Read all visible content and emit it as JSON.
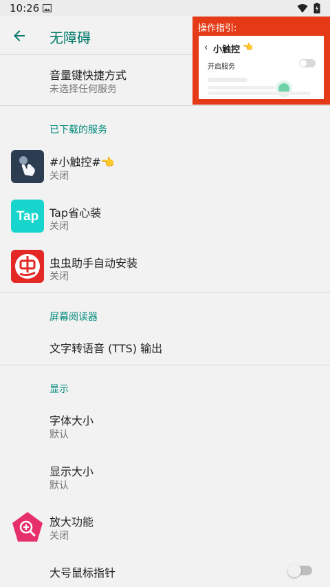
{
  "statusbar": {
    "time": "10:26"
  },
  "header": {
    "title": "无障碍"
  },
  "guide": {
    "label": "操作指引:",
    "card_title": "小触控",
    "hand": "👈",
    "row_label": "开启服务"
  },
  "shortcut": {
    "title": "音量键快捷方式",
    "summary": "未选择任何服务"
  },
  "downloaded": {
    "header": "已下载的服务",
    "items": [
      {
        "title": "#小触控#👈",
        "summary": "关闭"
      },
      {
        "title": "Tap省心装",
        "summary": "关闭"
      },
      {
        "title": "虫虫助手自动安装",
        "summary": "关闭"
      }
    ]
  },
  "screen_reader": {
    "header": "屏幕阅读器",
    "tts": "文字转语音 (TTS) 输出"
  },
  "display": {
    "header": "显示",
    "font_size": {
      "title": "字体大小",
      "summary": "默认"
    },
    "display_size": {
      "title": "显示大小",
      "summary": "默认"
    },
    "magnification": {
      "title": "放大功能",
      "summary": "关闭"
    },
    "large_pointer": {
      "title": "大号鼠标指针"
    }
  },
  "colors": {
    "accent": "#00897b",
    "title": "#00796b",
    "guide_bg": "#e53a17"
  }
}
